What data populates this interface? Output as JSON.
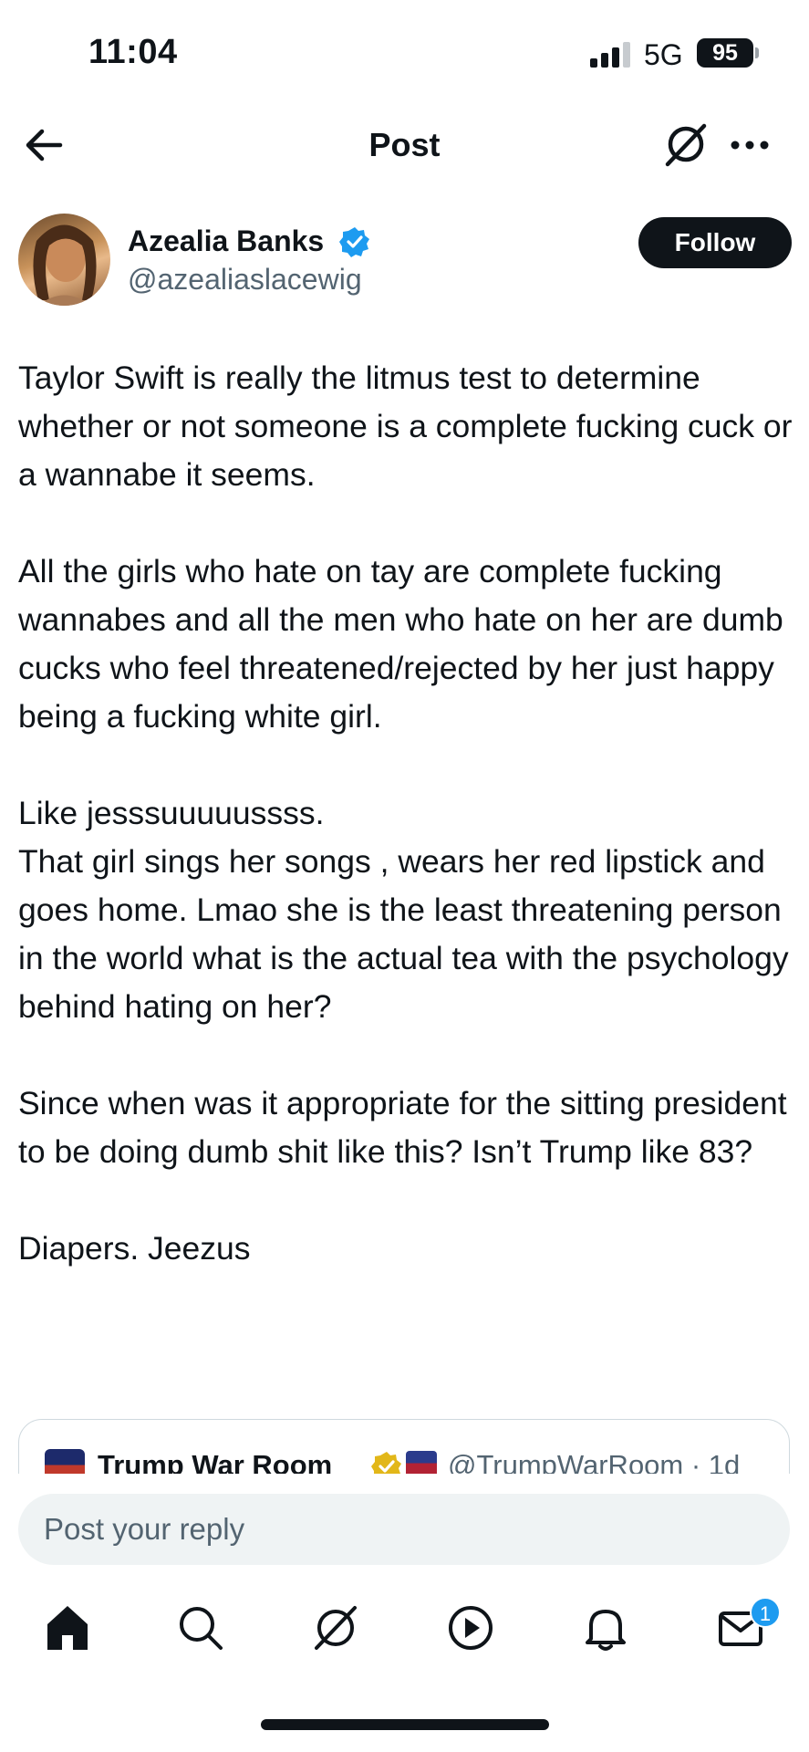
{
  "status_bar": {
    "time": "11:04",
    "network": "5G",
    "battery": "95"
  },
  "nav": {
    "title": "Post"
  },
  "author": {
    "name": "Azealia Banks",
    "handle": "@azealiaslacewig",
    "follow_label": "Follow"
  },
  "post": {
    "paragraph1": "Taylor Swift is really the litmus test to determine whether or not someone is a complete fucking cuck or a wannabe it seems.",
    "paragraph2": "All the girls who hate on tay are complete fucking wannabes and all the men who hate on her are dumb cucks who feel threatened/rejected by her just happy being a fucking white girl.",
    "paragraph3": "Like jesssuuuuussss.\nThat girl sings her songs , wears her red lipstick and goes home. Lmao she is the least threatening person in the world what is the actual tea with the psychology behind hating on her?",
    "paragraph4": "Since when was it appropriate for the sitting president to be doing dumb shit like this? Isn’t Trump like 83?",
    "paragraph5": "Diapers. Jeezus"
  },
  "quote": {
    "name": "Trump War Room",
    "handle_time": "@TrumpWarRoom · 1d"
  },
  "reply": {
    "placeholder": "Post your reply"
  },
  "tabs": {
    "messages_badge": "1"
  },
  "colors": {
    "accent": "#1d9bf0",
    "text": "#0f1419",
    "secondary": "#536471",
    "gold_badge": "#e2b719"
  }
}
